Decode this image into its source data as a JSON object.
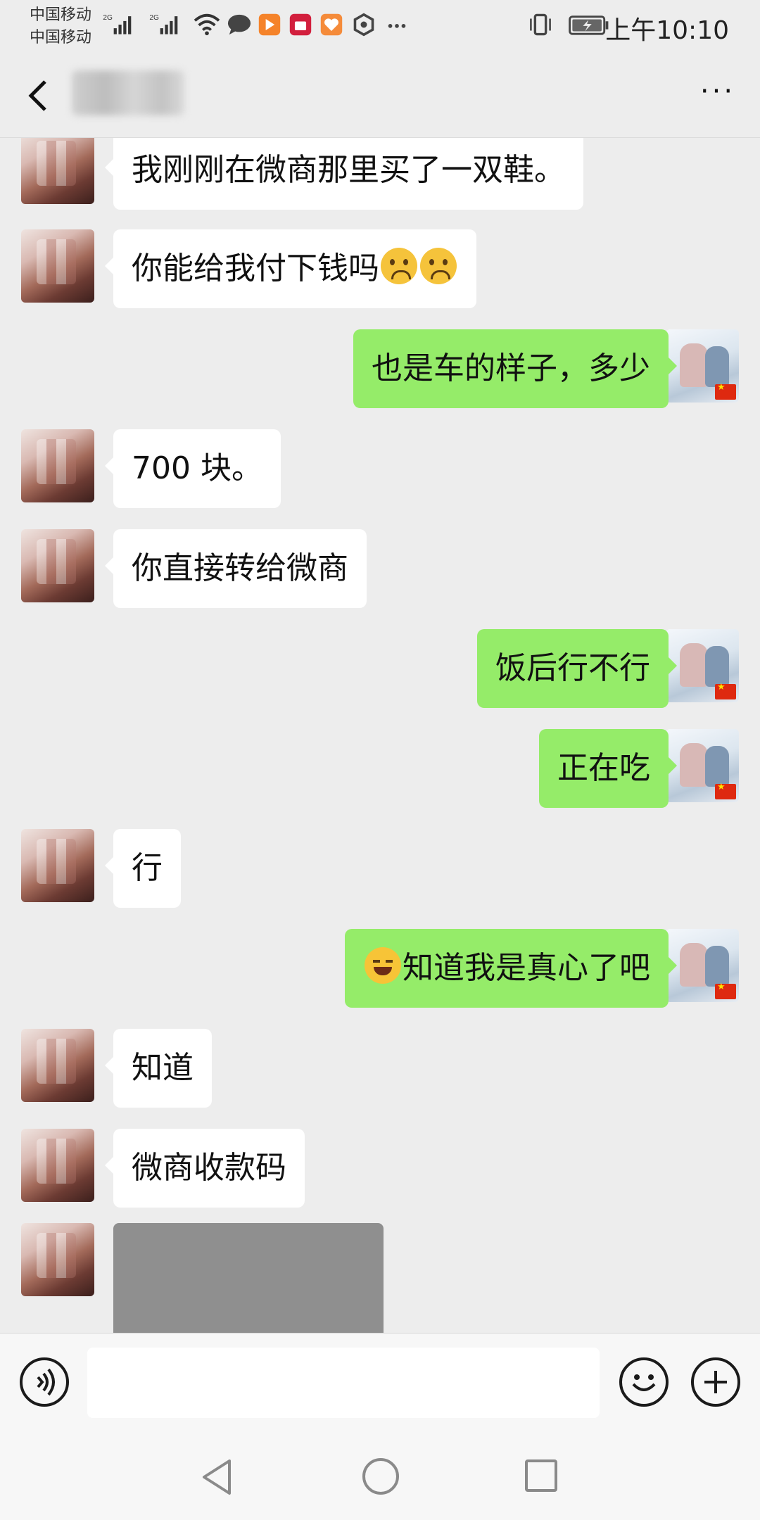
{
  "status_bar": {
    "carrier_1": "中国移动",
    "carrier_2": "中国移动",
    "network_1": "2G",
    "network_2": "2G",
    "time": "上午10:10",
    "icons": [
      "signal-icon",
      "wifi-icon",
      "message-icon",
      "app-icon",
      "tmall-icon",
      "health-icon",
      "shield-icon",
      "more-icon",
      "vibrate-icon",
      "battery-icon"
    ]
  },
  "header": {
    "chat_title": "",
    "more_label": "···"
  },
  "messages": [
    {
      "side": "left",
      "text": "我刚刚在微商那里买了一双鞋。"
    },
    {
      "side": "left",
      "text": "你能给我付下钱吗",
      "emoji_after": [
        "frowning-emoji",
        "frowning-emoji"
      ]
    },
    {
      "side": "right",
      "text": "也是车的样子，多少"
    },
    {
      "side": "left",
      "text": "700 块。"
    },
    {
      "side": "left",
      "text": "你直接转给微商"
    },
    {
      "side": "right",
      "text": "饭后行不行"
    },
    {
      "side": "right",
      "text": "正在吃"
    },
    {
      "side": "left",
      "text": "行"
    },
    {
      "side": "right",
      "text": "知道我是真心了吧",
      "emoji_before": [
        "laughing-tears-emoji"
      ]
    },
    {
      "side": "left",
      "text": "知道"
    },
    {
      "side": "left",
      "text": "微商收款码"
    },
    {
      "side": "left",
      "type": "image",
      "text": ""
    }
  ],
  "input_bar": {
    "placeholder": "",
    "voice_icon": "voice-icon",
    "emoji_icon": "emoji-icon",
    "plus_icon": "plus-icon"
  },
  "nav_bar": {
    "icons": [
      "nav-back-icon",
      "nav-home-icon",
      "nav-recent-icon"
    ]
  }
}
